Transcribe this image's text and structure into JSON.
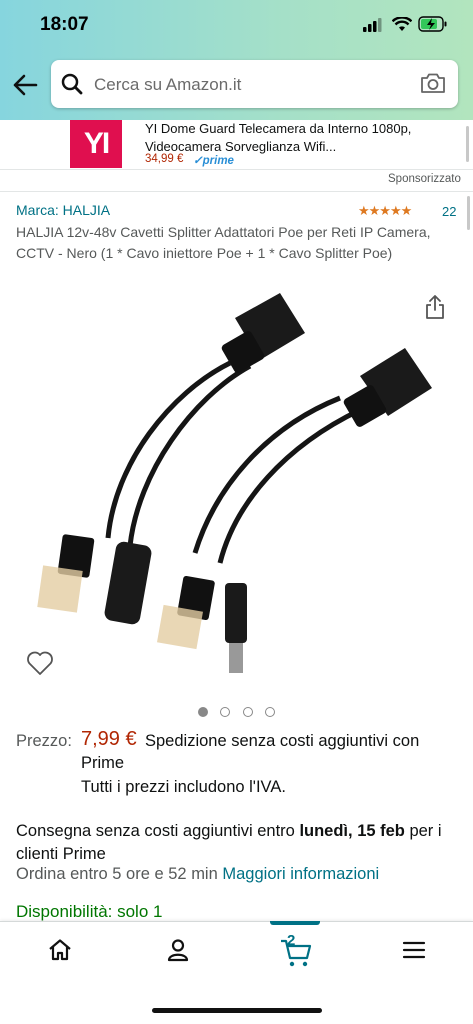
{
  "status": {
    "time": "18:07"
  },
  "search": {
    "placeholder": "Cerca su Amazon.it"
  },
  "ad": {
    "logo_text": "YI",
    "title": "YI Dome Guard Telecamera da Interno 1080p, Videocamera Sorveglianza Wifi...",
    "price": "34,99 €",
    "prime": "✓prime",
    "sponsored": "Sponsorizzato"
  },
  "product": {
    "brand": "Marca: HALJIA",
    "rating_stars": "★★★★★",
    "rating_value": 4.5,
    "review_count": "22",
    "title": "HALJIA 12v-48v Cavetti Splitter Adattatori Poe per Reti IP Camera, CCTV - Nero (1 * Cavo iniettore Poe + 1 * Cavo Splitter Poe)",
    "image_count": 4,
    "image_active": 1
  },
  "pricing": {
    "label": "Prezzo:",
    "value": "7,99 €",
    "shipping_line1": "Spedizione senza costi aggiuntivi con",
    "shipping_line2": "Prime",
    "vat": "Tutti i prezzi includono l'IVA."
  },
  "delivery": {
    "prefix": "Consegna senza costi aggiuntivi entro ",
    "date": "lunedì, 15 feb",
    "suffix": " per i clienti Prime",
    "order_prefix": "Ordina entro 5 ore e 52 min ",
    "more_info": "Maggiori informazioni"
  },
  "availability": "Disponibilità: solo 1",
  "tabbar": {
    "cart_count": "2",
    "active_tab": "cart"
  },
  "colors": {
    "link": "#007185",
    "price": "#b12704",
    "star": "#de7921",
    "header": "#86d5de",
    "instock": "#007600"
  }
}
